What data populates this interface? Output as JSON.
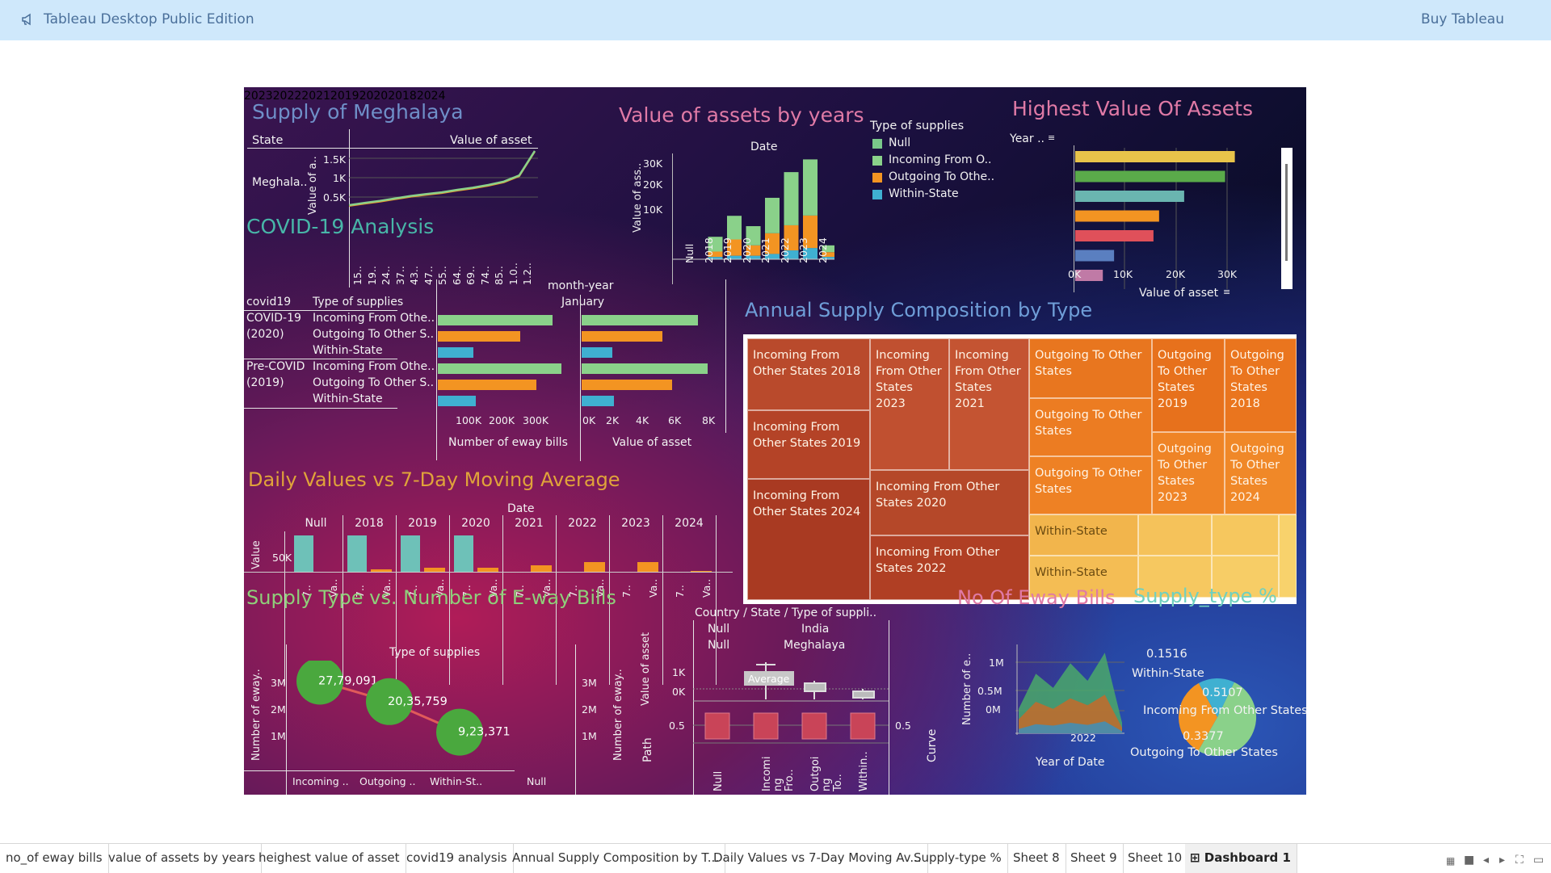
{
  "app": {
    "title": "Tableau Desktop Public Edition",
    "buy": "Buy Tableau"
  },
  "colors": {
    "incoming": "#8ad18a",
    "outgoing": "#f39422",
    "within": "#3fb0d1",
    "null": "#79c78a"
  },
  "meghalaya": {
    "title": "Supply of Meghalaya",
    "col_state": "State",
    "col_value": "Value of asset",
    "row": "Meghala..",
    "ylabel": "Value of a..",
    "yticks": [
      "1.5K",
      "1K",
      "0.5K"
    ],
    "xticks": [
      "15..",
      "19..",
      "24..",
      "37..",
      "43..",
      "47..",
      "55..",
      "64..",
      "69..",
      "74..",
      "85..",
      "1.0..",
      "1.2.."
    ]
  },
  "assets_years": {
    "title": "Value of assets by years",
    "axis_title": "Date",
    "ylabel": "Value of ass..",
    "yticks": [
      "30K",
      "20K",
      "10K"
    ],
    "legend_title": "Type of supplies",
    "legend": [
      "Null",
      "Incoming From O..",
      "Outgoing To Othe..",
      "Within-State"
    ]
  },
  "highest": {
    "title": "Highest Value Of Assets",
    "year_label": "Year ..",
    "xlabel": "Value of asset",
    "xticks": [
      "0K",
      "10K",
      "20K",
      "30K"
    ],
    "years": [
      "2023",
      "2022",
      "2021",
      "2019",
      "2020",
      "2018",
      "2024"
    ]
  },
  "covid": {
    "title": "COVID-19 Analysis",
    "col_covid": "covid19",
    "col_type": "Type of supplies",
    "header": "month-year",
    "month": "January",
    "group1": [
      "COVID-19",
      "(2020)"
    ],
    "group2": [
      "Pre-COVID",
      "(2019)"
    ],
    "types": [
      "Incoming From Othe..",
      "Outgoing To Other S..",
      "Within-State"
    ],
    "xticks1": [
      "100K",
      "200K",
      "300K"
    ],
    "xticks2": [
      "0K",
      "2K",
      "4K",
      "6K",
      "8K"
    ],
    "xlabel1": "Number of eway bills",
    "xlabel2": "Value of asset"
  },
  "treemap": {
    "title": "Annual Supply Composition by Type",
    "tiles": [
      "Incoming From Other States 2018",
      "Incoming From Other States 2019",
      "Incoming From Other States 2024",
      "Incoming From Other States 2023",
      "Incoming From Other States 2021",
      "Incoming From Other States 2020",
      "Incoming From Other States 2022",
      "Outgoing To Other States",
      "Outgoing To Other States",
      "Outgoing To Other States",
      "Outgoing To Other States 2019",
      "Outgoing To Other States 2018",
      "Outgoing To Other States 2023",
      "Outgoing To Other States 2024",
      "Within-State",
      "Within-State"
    ]
  },
  "daily": {
    "title": "Daily Values vs 7-Day Moving Average",
    "axis_title": "Date",
    "ylabel": "Value",
    "ytick": "50K",
    "years": [
      "Null",
      "2018",
      "2019",
      "2020",
      "2021",
      "2022",
      "2023",
      "2024"
    ],
    "sub": [
      "7..",
      "Va.."
    ]
  },
  "supply_type": {
    "title": "Supply Type vs. Number of E-way Bills",
    "header": "Type of supplies",
    "ylabel": "Number of eway..",
    "yticks": [
      "3M",
      "2M",
      "1M"
    ],
    "categories": [
      "Incoming ..",
      "Outgoing ..",
      "Within-St..",
      "Null"
    ],
    "labels": [
      "27,79,091",
      "20,35,759",
      "9,23,371"
    ]
  },
  "box": {
    "header": "Country / State / Type of suppli..",
    "null1": "Null",
    "null2": "Null",
    "country": "India",
    "state": "Meghalaya",
    "ylabel": "Value of asset",
    "yticks": [
      "1K",
      "0K"
    ],
    "tooltip": "Average",
    "path_label": "Path",
    "curve_label": "Curve",
    "tick05": "0.5",
    "cats": [
      "Null",
      "Incomi ng Fro..",
      "Outgoi ng To..",
      "Within.."
    ]
  },
  "eway": {
    "title": "No Of Eway Bills",
    "ylabel": "Number of e..",
    "yticks": [
      "1M",
      "0.5M",
      "0M"
    ],
    "xtick": "2022",
    "xlabel": "Year of Date"
  },
  "pie": {
    "title": "Supply_type %",
    "labels": [
      "0.1516",
      "Within-State",
      "0.5107",
      "Incoming From Other States",
      "0.3377",
      "Outgoing To Other States"
    ]
  },
  "tabs": [
    "no_of eway bills",
    "value of assets by years",
    "heighest value of asset",
    "covid19 analysis",
    "Annual Supply Composition by T...",
    "Daily Values vs 7-Day Moving Av...",
    "Supply-type %",
    "Sheet 8",
    "Sheet 9",
    "Sheet 10",
    "Dashboard 1"
  ],
  "chart_data": [
    {
      "type": "line",
      "title": "Supply of Meghalaya",
      "xlabel": "",
      "ylabel": "Value of a..",
      "ylim": [
        0,
        1900
      ],
      "series": [
        {
          "name": "Meghalaya",
          "values": [
            80,
            150,
            220,
            300,
            380,
            440,
            500,
            580,
            650,
            740,
            850,
            1050,
            1850
          ]
        }
      ]
    },
    {
      "type": "bar",
      "title": "Value of assets by years",
      "categories": [
        "Null",
        "2018",
        "2019",
        "2020",
        "2021",
        "2022",
        "2023",
        "2024"
      ],
      "ylim": [
        0,
        35000
      ],
      "series": [
        {
          "name": "Within-State",
          "values": [
            0,
            800,
            1200,
            1200,
            1800,
            3000,
            3800,
            800
          ]
        },
        {
          "name": "Outgoing To Othe..",
          "values": [
            0,
            1800,
            5500,
            3500,
            7000,
            8500,
            11000,
            1600
          ]
        },
        {
          "name": "Incoming From O..",
          "values": [
            0,
            5000,
            8000,
            6500,
            12000,
            18000,
            19000,
            2300
          ]
        }
      ]
    },
    {
      "type": "bar",
      "title": "Highest Value Of Assets",
      "categories": [
        "2023",
        "2022",
        "2021",
        "2019",
        "2020",
        "2018",
        "2024"
      ],
      "values": [
        31200,
        29300,
        21300,
        16400,
        15300,
        7600,
        5400
      ]
    },
    {
      "type": "bar",
      "title": "COVID-19 Analysis",
      "categories": [
        "COVID-19 Incoming",
        "COVID-19 Outgoing",
        "COVID-19 Within",
        "Pre-COVID Incoming",
        "Pre-COVID Outgoing",
        "Pre-COVID Within"
      ],
      "series": [
        {
          "name": "Number of eway bills",
          "values": [
            320000,
            230000,
            100000,
            345000,
            275000,
            105000
          ]
        },
        {
          "name": "Value of asset",
          "values": [
            7200,
            5000,
            1900,
            7800,
            5600,
            2000
          ]
        }
      ]
    },
    {
      "type": "bar",
      "title": "Daily Values vs 7-Day Moving Average",
      "categories": [
        "Null",
        "2018",
        "2019",
        "2020",
        "2021",
        "2022",
        "2023",
        "2024"
      ],
      "series": [
        {
          "name": "7..",
          "values": [
            82000,
            82000,
            82000,
            82000,
            0,
            0,
            0,
            0
          ]
        },
        {
          "name": "Va..",
          "values": [
            0,
            5000,
            10000,
            10000,
            15000,
            22000,
            22000,
            2000
          ]
        }
      ]
    },
    {
      "type": "scatter",
      "title": "Supply Type vs. Number of E-way Bills",
      "categories": [
        "Incoming ..",
        "Outgoing ..",
        "Within-St..",
        "Null"
      ],
      "values": [
        2779091,
        2035759,
        923371,
        null
      ]
    },
    {
      "type": "area",
      "title": "No Of Eway Bills",
      "xlabel": "Year of Date",
      "ylim": [
        0,
        1200000
      ],
      "series": [
        {
          "name": "Incoming From Other States",
          "values": [
            350000,
            850000,
            650000,
            1000000,
            750000,
            1150000,
            150000
          ]
        },
        {
          "name": "Outgoing To Other States",
          "values": [
            200000,
            450000,
            350000,
            500000,
            400000,
            550000,
            80000
          ]
        },
        {
          "name": "Within-State",
          "values": [
            60000,
            130000,
            110000,
            150000,
            120000,
            170000,
            30000
          ]
        }
      ]
    },
    {
      "type": "pie",
      "title": "Supply_type %",
      "categories": [
        "Incoming From Other States",
        "Outgoing To Other States",
        "Within-State"
      ],
      "values": [
        0.5107,
        0.3377,
        0.1516
      ]
    }
  ]
}
